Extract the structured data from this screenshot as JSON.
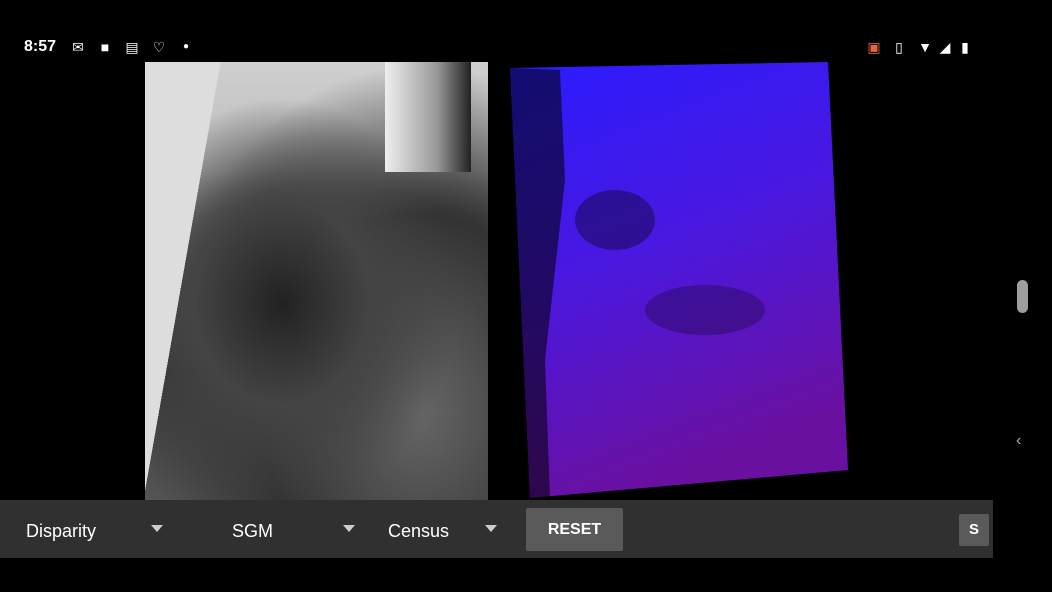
{
  "status_bar": {
    "time": "8:57",
    "left_icons": [
      "gmail-icon",
      "video-camera-icon",
      "calendar-icon",
      "heart-check-icon",
      "dot-icon"
    ],
    "right_icons": [
      "cast-icon",
      "vibrate-icon",
      "wifi-icon",
      "cell-signal-icon",
      "battery-icon"
    ],
    "cast_color": "#e8663d"
  },
  "toolbar": {
    "mode": "Disparity",
    "algorithm": "SGM",
    "cost": "Census",
    "reset_label": "RESET",
    "s_label": "S"
  },
  "colors": {
    "toolbar_bg": "#303030",
    "button_bg": "#5a5a5a",
    "depth_near": "#6a10a0",
    "depth_far": "#2a1cff"
  }
}
